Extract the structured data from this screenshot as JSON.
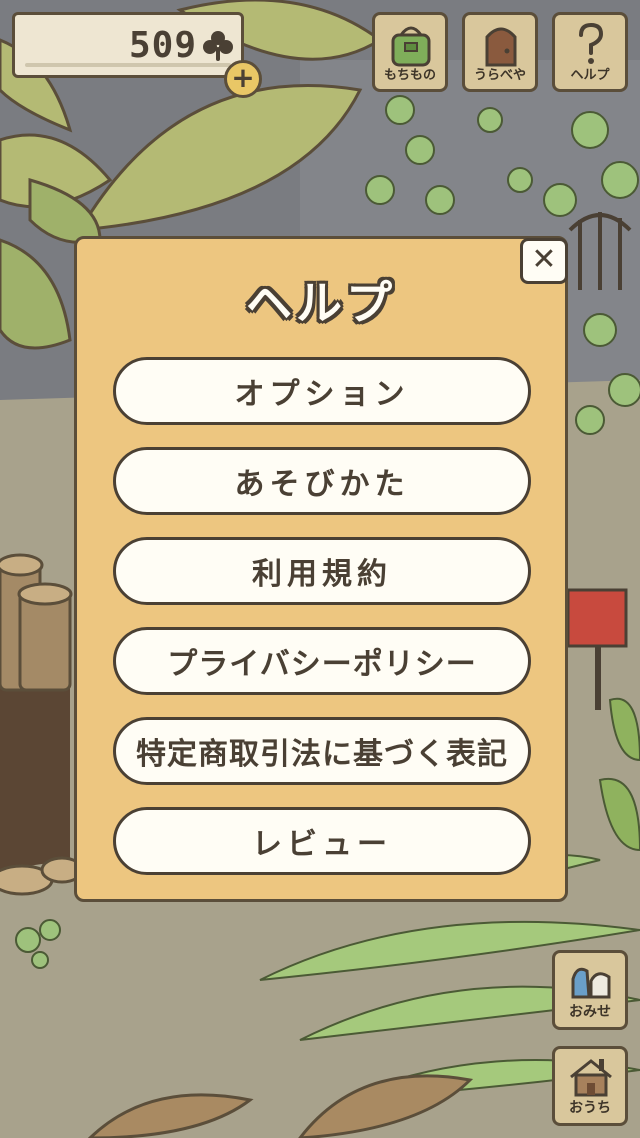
{
  "clover_counter": {
    "value": "509",
    "icon": "clover-icon",
    "add_icon": "plus"
  },
  "top_buttons": [
    {
      "label": "もちもの",
      "icon": "bag-icon"
    },
    {
      "label": "うらべや",
      "icon": "door-icon"
    },
    {
      "label": "ヘルプ",
      "icon": "question-icon"
    }
  ],
  "side_buttons": [
    {
      "label": "おみせ",
      "icon": "shop-icon"
    },
    {
      "label": "おうち",
      "icon": "house-icon"
    }
  ],
  "dialog": {
    "title": "ヘルプ",
    "close_glyph": "✕",
    "items": [
      {
        "label": "オプション"
      },
      {
        "label": "あそびかた"
      },
      {
        "label": "利用規約"
      },
      {
        "label": "プライバシーポリシー"
      },
      {
        "label": "特定商取引法に基づく表記"
      },
      {
        "label": "レビュー"
      }
    ]
  },
  "colors": {
    "panel": "#edc680",
    "button_fill": "#fffdf5",
    "outline": "#4a4034",
    "background_dim": "#7d7f84"
  }
}
